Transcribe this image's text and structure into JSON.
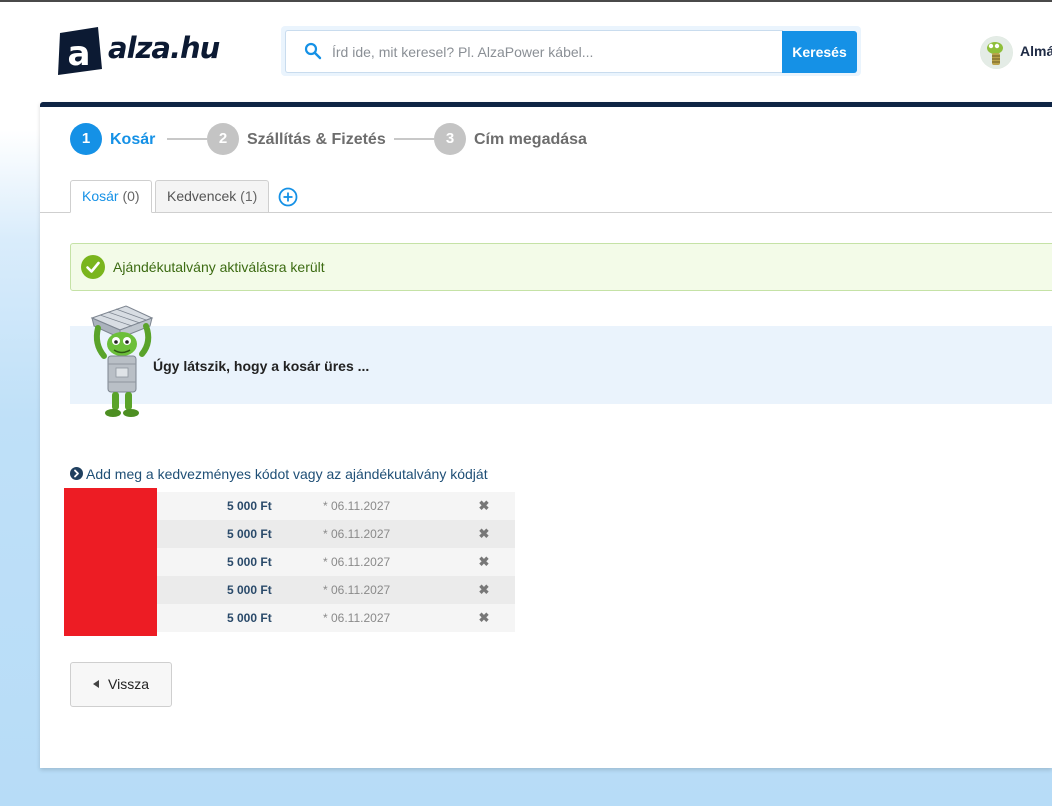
{
  "header": {
    "logo_text": "alza.hu",
    "search_placeholder": "Írd ide, mit keresel? Pl. AlzaPower kábel...",
    "search_button": "Keresés",
    "user_name": "Almá"
  },
  "steps": [
    {
      "number": "1",
      "label": "Kosár",
      "active": true
    },
    {
      "number": "2",
      "label": "Szállítás & Fizetés",
      "active": false
    },
    {
      "number": "3",
      "label": "Cím megadása",
      "active": false
    }
  ],
  "tabs": [
    {
      "label": "Kosár",
      "count": "(0)",
      "active": true
    },
    {
      "label": "Kedvencek",
      "count": "(1)",
      "active": false
    }
  ],
  "alert": {
    "text": "Ajándékutalvány aktiválásra került"
  },
  "empty_cart": {
    "text": "Úgy látszik, hogy a kosár üres ..."
  },
  "voucher": {
    "link_text": "Add meg a kedvezményes kódot vagy az ajándékutalvány kódját",
    "rows": [
      {
        "amount": "5 000 Ft",
        "date": "* 06.11.2027"
      },
      {
        "amount": "5 000 Ft",
        "date": "* 06.11.2027"
      },
      {
        "amount": "5 000 Ft",
        "date": "* 06.11.2027"
      },
      {
        "amount": "5 000 Ft",
        "date": "* 06.11.2027"
      },
      {
        "amount": "5 000 Ft",
        "date": "* 06.11.2027"
      }
    ]
  },
  "back_button": "Vissza",
  "colors": {
    "accent": "#1591e6",
    "navy": "#0e2444",
    "success": "#7ab51d",
    "redaction": "#ed1c24",
    "step_inactive": "#c4c4c4"
  },
  "icons": {
    "search": "search-icon",
    "alert": "check-circle-icon",
    "add_tab": "plus-circle-icon",
    "voucher": "arrow-circle-right-icon",
    "remove": "close-icon",
    "back": "caret-left-icon"
  }
}
